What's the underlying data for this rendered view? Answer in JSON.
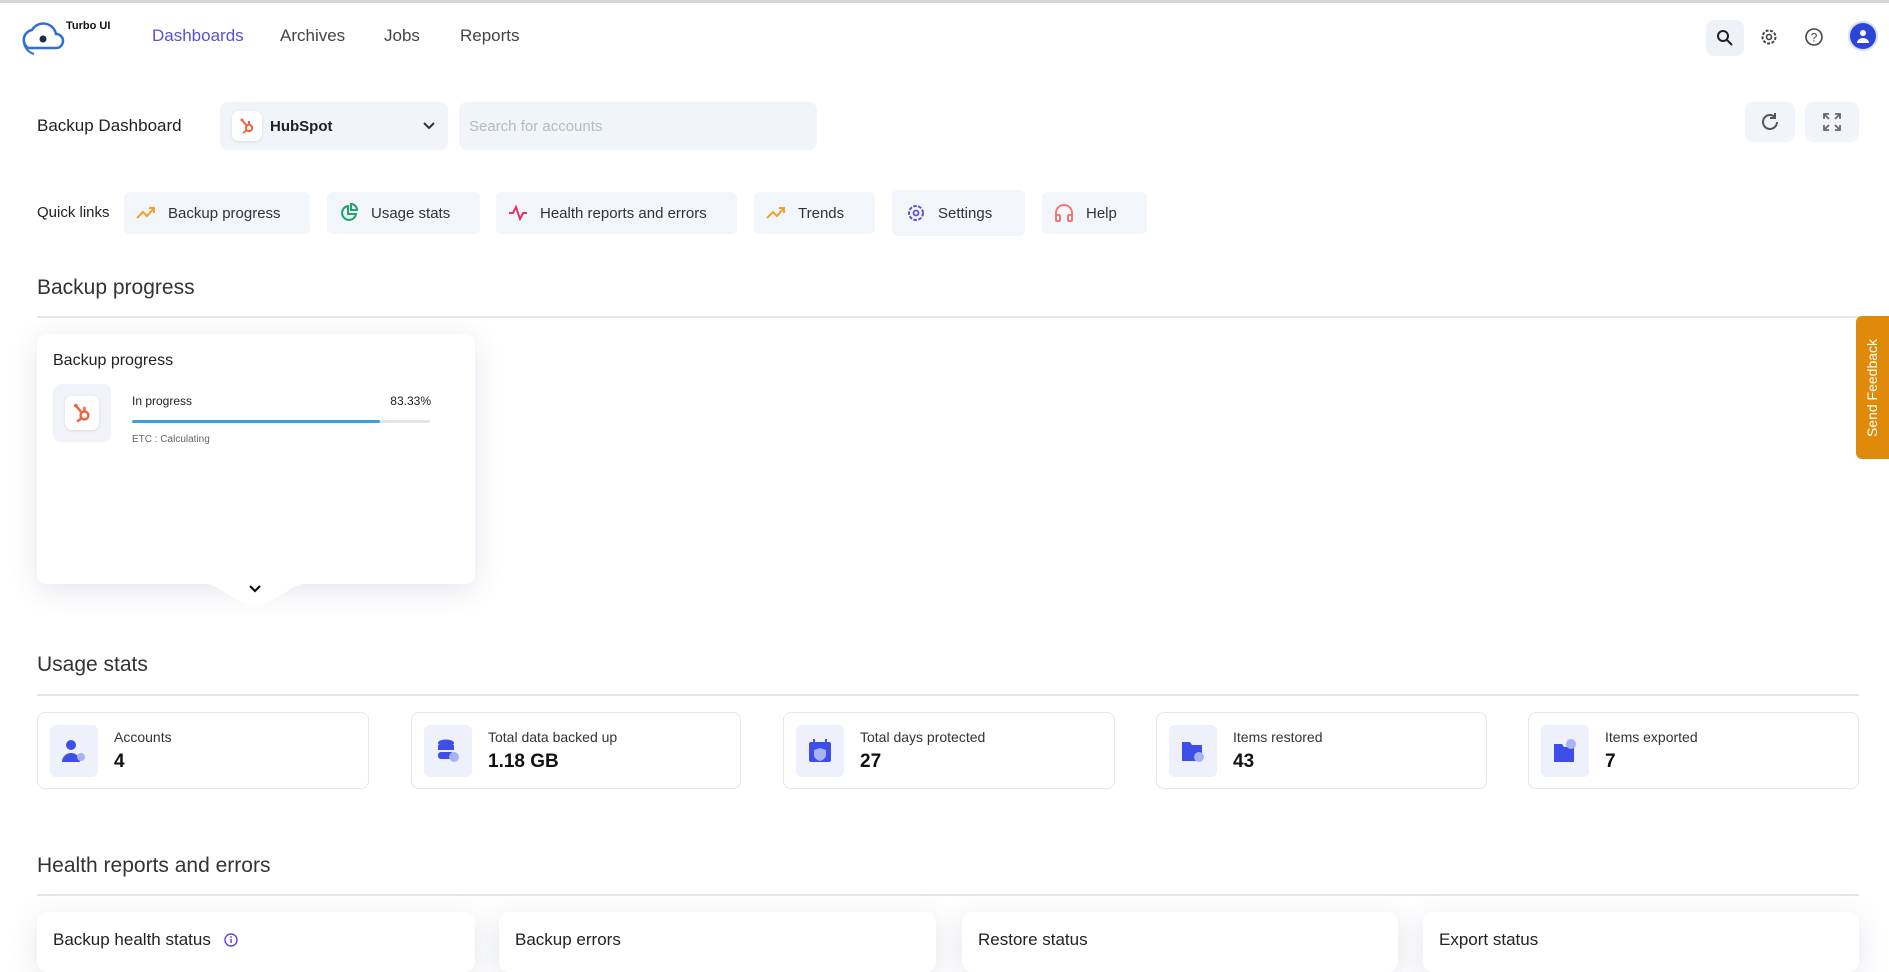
{
  "app": {
    "name": "Turbo UI"
  },
  "nav": {
    "items": [
      {
        "label": "Dashboards",
        "active": true
      },
      {
        "label": "Archives"
      },
      {
        "label": "Jobs"
      },
      {
        "label": "Reports"
      }
    ]
  },
  "header": {
    "title": "Backup Dashboard",
    "app_select": "HubSpot",
    "search_placeholder": "Search for accounts"
  },
  "quick_links": {
    "label": "Quick links",
    "items": [
      {
        "label": "Backup progress",
        "icon": "trend-up-icon",
        "color": "#f0a030"
      },
      {
        "label": "Usage stats",
        "icon": "pie-chart-icon",
        "color": "#1fa36b"
      },
      {
        "label": "Health reports and errors",
        "icon": "pulse-icon",
        "color": "#e0336b"
      },
      {
        "label": "Trends",
        "icon": "trend-up-icon",
        "color": "#f0a030"
      },
      {
        "label": "Settings",
        "icon": "gear-icon",
        "color": "#5a4fd6"
      },
      {
        "label": "Help",
        "icon": "headset-icon",
        "color": "#f07a7a"
      }
    ]
  },
  "backup_progress": {
    "section_title": "Backup progress",
    "card_title": "Backup progress",
    "status": "In progress",
    "percent_label": "83.33%",
    "percent": 83.33,
    "etc": "ETC : Calculating"
  },
  "usage_stats": {
    "section_title": "Usage stats",
    "items": [
      {
        "label": "Accounts",
        "value": "4"
      },
      {
        "label": "Total data backed up",
        "value": "1.18 GB"
      },
      {
        "label": "Total days protected",
        "value": "27"
      },
      {
        "label": "Items restored",
        "value": "43"
      },
      {
        "label": "Items exported",
        "value": "7"
      }
    ]
  },
  "health": {
    "section_title": "Health reports and errors",
    "cards": [
      "Backup health status",
      "Backup errors",
      "Restore status",
      "Export status"
    ]
  },
  "feedback": "Send Feedback",
  "colors": {
    "accent": "#5a4fd6",
    "progress": "#3aa0e6",
    "feedback": "#e08a0b",
    "stat_icon": "#3d4fe8"
  }
}
